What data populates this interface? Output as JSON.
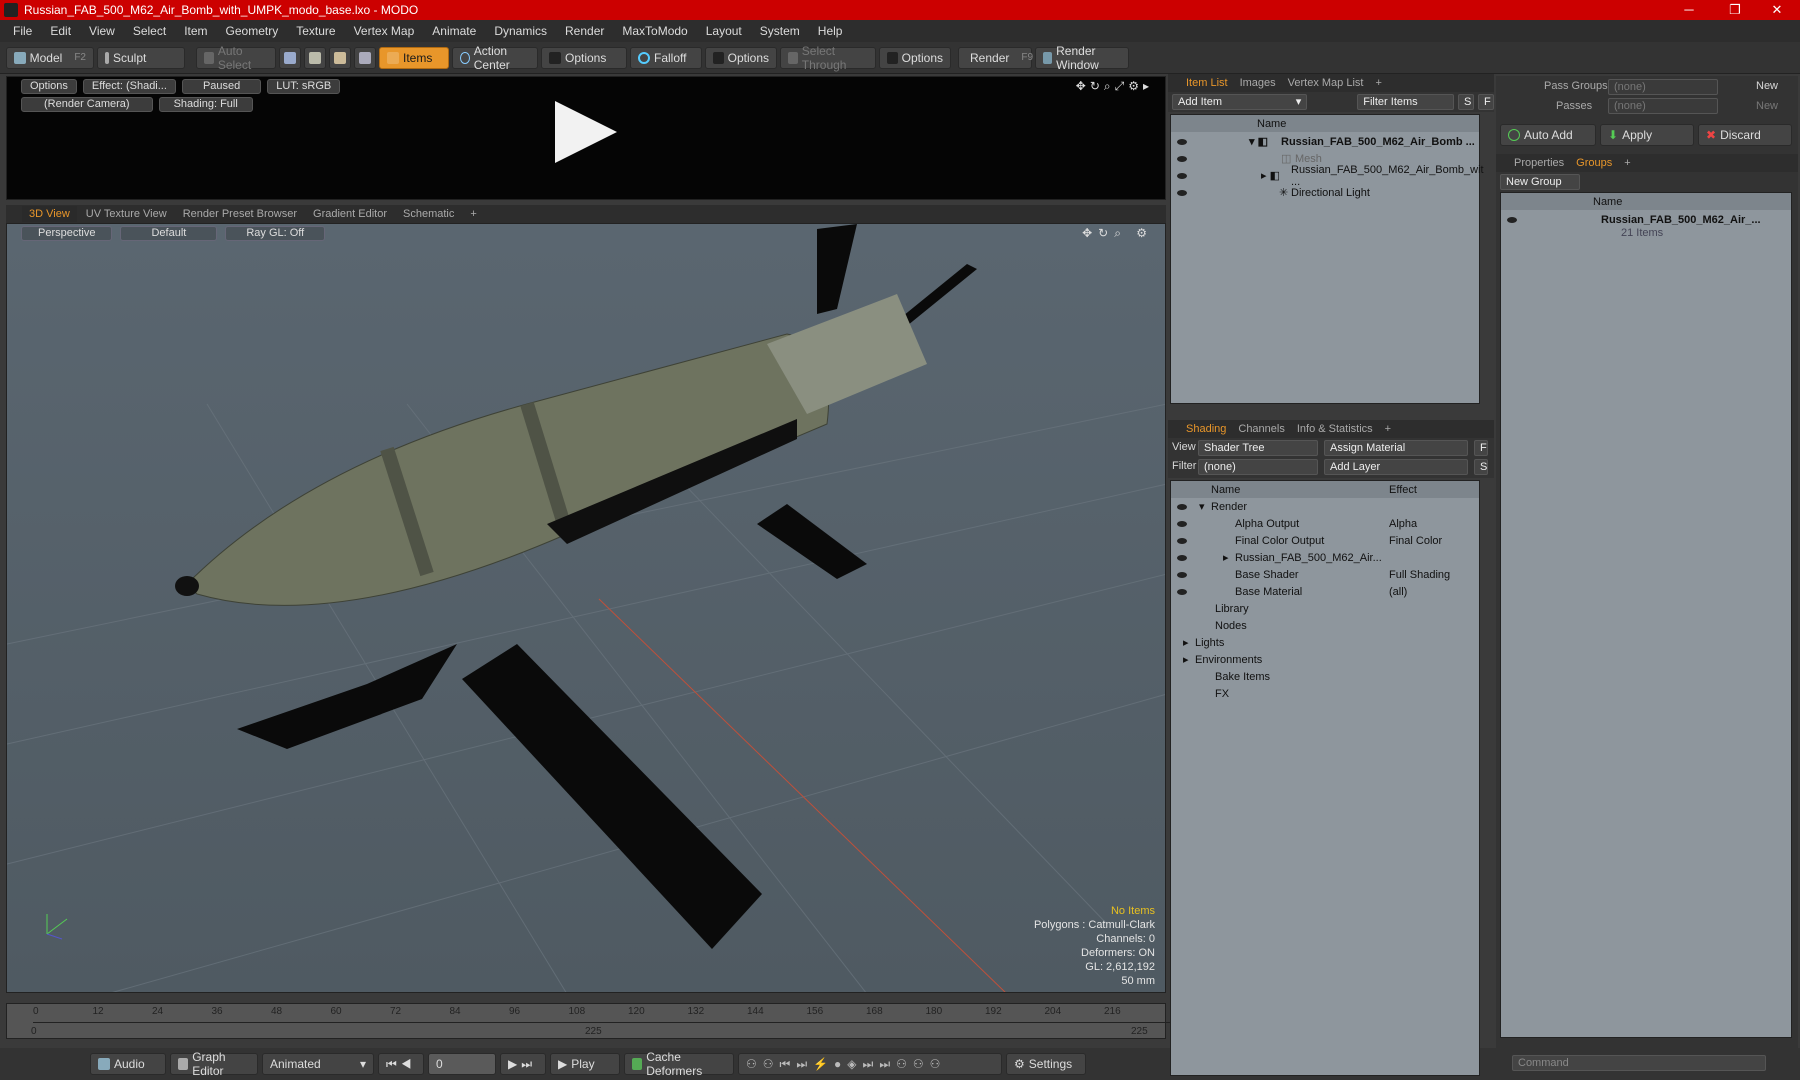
{
  "window": {
    "title": "Russian_FAB_500_M62_Air_Bomb_with_UMPK_modo_base.lxo - MODO",
    "minimize": "─",
    "maximize": "❐",
    "close": "✕"
  },
  "menu": [
    "File",
    "Edit",
    "View",
    "Select",
    "Item",
    "Geometry",
    "Texture",
    "Vertex Map",
    "Animate",
    "Dynamics",
    "Render",
    "MaxToModo",
    "Layout",
    "System",
    "Help"
  ],
  "toolbar": {
    "model": "Model",
    "model_key": "F2",
    "sculpt": "Sculpt",
    "auto_select": "Auto Select",
    "items": "Items",
    "action_center": "Action Center",
    "options1": "Options",
    "falloff": "Falloff",
    "options2": "Options",
    "select_through": "Select Through",
    "options3": "Options",
    "render": "Render",
    "render_key": "F9",
    "render_window": "Render Window"
  },
  "preview": {
    "options": "Options",
    "effect": "Effect: (Shadi...",
    "paused": "Paused",
    "lut": "LUT: sRGB",
    "camera": "(Render Camera)",
    "shading": "Shading: Full"
  },
  "viewtabs": [
    "3D View",
    "UV Texture View",
    "Render Preset Browser",
    "Gradient Editor",
    "Schematic",
    "+"
  ],
  "viewport": {
    "perspective": "Perspective",
    "default": "Default",
    "raygl": "Ray GL: Off",
    "hud": {
      "no_items": "No Items",
      "polygons": "Polygons : Catmull-Clark",
      "channels": "Channels: 0",
      "deformers": "Deformers: ON",
      "gl": "GL: 2,612,192",
      "scale": "50 mm"
    }
  },
  "timeline": {
    "ticks": [
      "0",
      "12",
      "24",
      "36",
      "48",
      "60",
      "72",
      "84",
      "96",
      "108",
      "120",
      "132",
      "144",
      "156",
      "168",
      "180",
      "192",
      "204",
      "216"
    ],
    "start": "0",
    "mid": "225",
    "end": "225"
  },
  "bottom": {
    "audio": "Audio",
    "graph_editor": "Graph Editor",
    "animated": "Animated",
    "frame": "0",
    "play": "Play",
    "cache": "Cache Deformers",
    "settings": "Settings"
  },
  "itemlist": {
    "tabs": [
      "Item List",
      "Images",
      "Vertex Map List",
      "+"
    ],
    "add_item": "Add Item",
    "filter_items": "Filter Items",
    "s": "S",
    "f": "F",
    "name_col": "Name",
    "rows": [
      "Russian_FAB_500_M62_Air_Bomb ...",
      "Mesh",
      "Russian_FAB_500_M62_Air_Bomb_wit ...",
      "Directional Light"
    ]
  },
  "shading": {
    "tabs": [
      "Shading",
      "Channels",
      "Info & Statistics",
      "+"
    ],
    "view_label": "View",
    "view_value": "Shader Tree",
    "assign_material": "Assign Material",
    "f": "F",
    "filter_label": "Filter",
    "filter_value": "(none)",
    "add_layer": "Add Layer",
    "s": "S",
    "name_col": "Name",
    "effect_col": "Effect",
    "rows": [
      {
        "name": "Render",
        "effect": ""
      },
      {
        "name": "Alpha Output",
        "effect": "Alpha"
      },
      {
        "name": "Final Color Output",
        "effect": "Final Color"
      },
      {
        "name": "Russian_FAB_500_M62_Air...",
        "effect": ""
      },
      {
        "name": "Base Shader",
        "effect": "Full Shading"
      },
      {
        "name": "Base Material",
        "effect": "(all)"
      },
      {
        "name": "Library",
        "effect": ""
      },
      {
        "name": "Nodes",
        "effect": ""
      },
      {
        "name": "Lights",
        "effect": ""
      },
      {
        "name": "Environments",
        "effect": ""
      },
      {
        "name": "Bake Items",
        "effect": ""
      },
      {
        "name": "FX",
        "effect": ""
      }
    ]
  },
  "passes": {
    "pass_groups": "Pass Groups",
    "passes": "Passes",
    "none1": "(none)",
    "none2": "(none)",
    "new1": "New",
    "new2": "New"
  },
  "actions": {
    "auto_add": "Auto Add",
    "apply": "Apply",
    "discard": "Discard"
  },
  "groups": {
    "tabs": [
      "Properties",
      "Groups",
      "+"
    ],
    "new_group": "New Group",
    "name_col": "Name",
    "group_name": "Russian_FAB_500_M62_Air_...",
    "group_count": "21 Items"
  },
  "command": {
    "placeholder": "Command"
  },
  "colors": {
    "accent": "#e8962a",
    "title_red": "#cc0000",
    "panel": "#8e969d"
  }
}
